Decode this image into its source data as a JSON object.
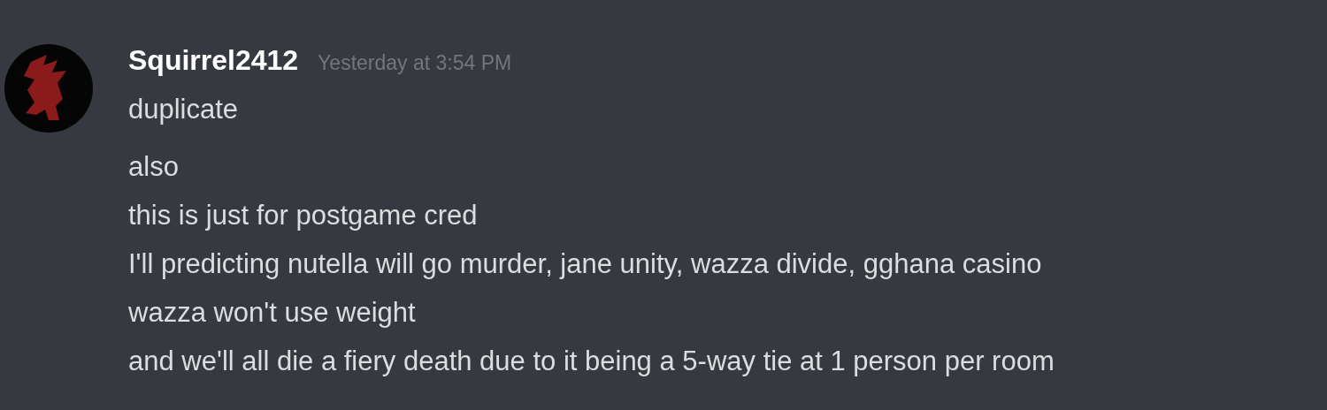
{
  "author": "Squirrel2412",
  "timestamp": "Yesterday at 3:54 PM",
  "messages": [
    {
      "lines": [
        "duplicate"
      ]
    },
    {
      "lines": [
        "also",
        "this is just for postgame cred",
        "I'll predicting nutella will go murder, jane unity, wazza divide, gghana casino",
        "wazza won't use weight",
        "and we'll all die a fiery death due to it being a 5-way tie at 1 person per room"
      ]
    }
  ]
}
